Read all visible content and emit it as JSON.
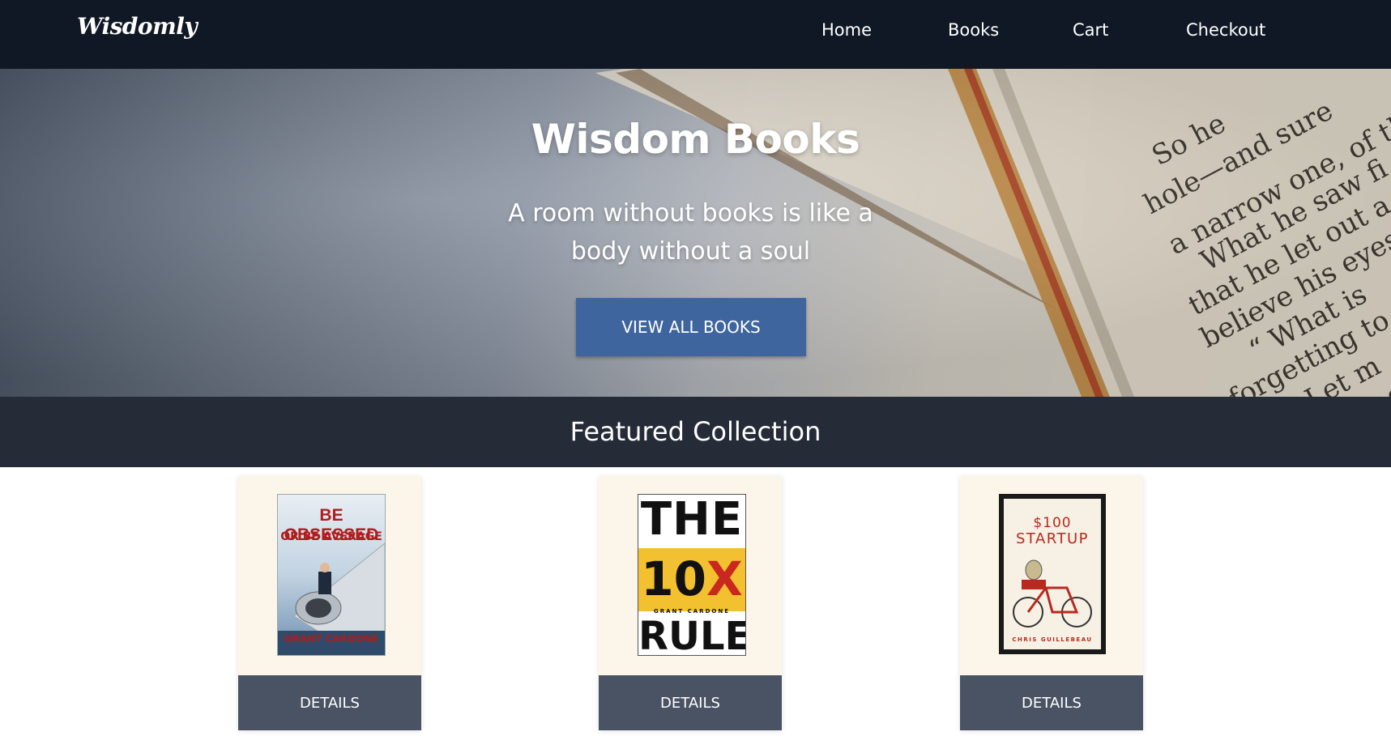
{
  "navbar": {
    "brand": "Wisdomly",
    "links": [
      "Home",
      "Books",
      "Cart",
      "Checkout"
    ]
  },
  "hero": {
    "title": "Wisdom Books",
    "tagline_line1": "A room without books is like a",
    "tagline_line2": "body without a soul",
    "button_label": "VIEW ALL BOOKS"
  },
  "featured": {
    "title": "Featured Collection",
    "books": [
      {
        "cover_title": "BE OBSESSED",
        "cover_subtitle": "OR BE AVERAGE",
        "cover_author": "GRANT CARDONE",
        "button_label": "DETAILS"
      },
      {
        "cover_title_top": "THE",
        "cover_title_num": "10",
        "cover_title_x": "X",
        "cover_title_bottom": "RULE",
        "cover_author": "GRANT CARDONE",
        "button_label": "DETAILS"
      },
      {
        "cover_title_top": "$100",
        "cover_title_bottom": "STARTUP",
        "cover_author": "CHRIS GUILLEBEAU",
        "button_label": "DETAILS"
      }
    ]
  },
  "colors": {
    "navbar_bg": "#101825",
    "hero_button": "#3f659f",
    "featured_bar": "#252c38",
    "details_button": "#4a5364",
    "card_bg": "#fcf5ea"
  }
}
